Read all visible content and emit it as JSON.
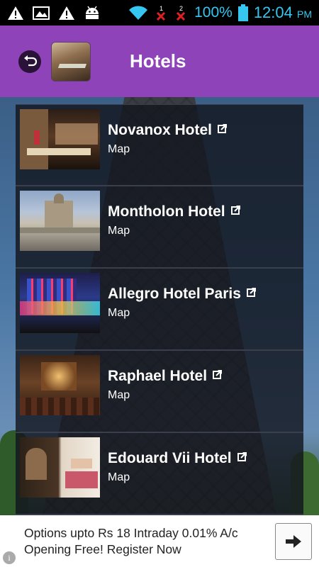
{
  "status_bar": {
    "battery_percent": "100%",
    "time": "12:04",
    "time_suffix": "PM",
    "icons": [
      "warning-icon",
      "image-icon",
      "warning-icon",
      "android-icon",
      "wifi-icon",
      "signal-1-icon",
      "signal-2-icon",
      "battery-icon"
    ]
  },
  "header": {
    "title": "Hotels",
    "back_icon": "back-arrow-icon"
  },
  "hotels": [
    {
      "name": "Novanox Hotel",
      "link": "Map"
    },
    {
      "name": "Montholon Hotel",
      "link": "Map"
    },
    {
      "name": "Allegro Hotel Paris",
      "link": "Map"
    },
    {
      "name": "Raphael Hotel",
      "link": "Map"
    },
    {
      "name": "Edouard Vii Hotel",
      "link": "Map"
    }
  ],
  "ad": {
    "line1": "Options upto Rs 18 Intraday 0.01% A/c",
    "line2": "Opening Free! Register Now",
    "button_icon": "arrow-right-icon",
    "info_glyph": "i"
  },
  "colors": {
    "header_bg": "#8e44b8",
    "status_text": "#35c7f0",
    "list_bg": "#12161e"
  }
}
